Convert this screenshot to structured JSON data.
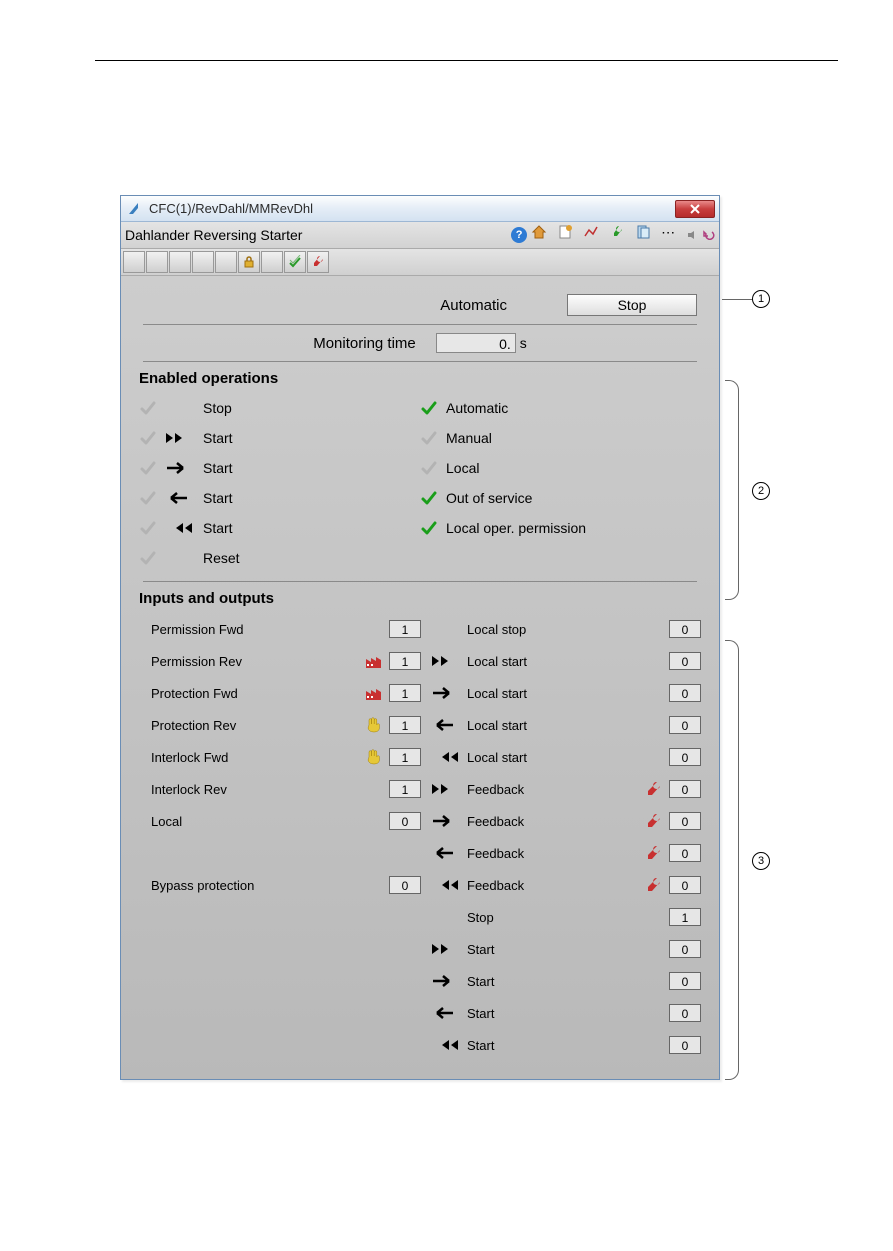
{
  "window": {
    "title": "CFC(1)/RevDahl/MMRevDhl",
    "subtitle": "Dahlander Reversing Starter"
  },
  "auto_row": {
    "label": "Automatic",
    "button": "Stop"
  },
  "monitoring": {
    "label": "Monitoring time",
    "value": "0.",
    "unit": "s"
  },
  "sections": {
    "enabled_ops": "Enabled operations",
    "io": "Inputs and outputs"
  },
  "ops_left": [
    {
      "label": "Stop",
      "chk": "gray",
      "arrow": ""
    },
    {
      "label": "Start",
      "chk": "gray",
      "arrow": "ff"
    },
    {
      "label": "Start",
      "chk": "gray",
      "arrow": "fwd"
    },
    {
      "label": "Start",
      "chk": "gray",
      "arrow": "rev"
    },
    {
      "label": "Start",
      "chk": "gray",
      "arrow": "rr"
    },
    {
      "label": "Reset",
      "chk": "gray",
      "arrow": ""
    }
  ],
  "ops_right": [
    {
      "label": "Automatic",
      "chk": "green"
    },
    {
      "label": "Manual",
      "chk": "gray"
    },
    {
      "label": "Local",
      "chk": "gray"
    },
    {
      "label": "Out of service",
      "chk": "green"
    },
    {
      "label": "Local oper. permission",
      "chk": "green"
    }
  ],
  "io_left": [
    {
      "label": "Permission Fwd",
      "val": "1",
      "icon": ""
    },
    {
      "label": "Permission Rev",
      "val": "1",
      "icon": "factory"
    },
    {
      "label": "Protection Fwd",
      "val": "1",
      "icon": "factory"
    },
    {
      "label": "Protection Rev",
      "val": "1",
      "icon": "hand"
    },
    {
      "label": "Interlock Fwd",
      "val": "1",
      "icon": "hand"
    },
    {
      "label": "Interlock Rev",
      "val": "1",
      "icon": ""
    },
    {
      "label": "Local",
      "val": "0",
      "icon": ""
    },
    {
      "label": "",
      "val": "",
      "icon": ""
    },
    {
      "label": "Bypass protection",
      "val": "0",
      "icon": ""
    }
  ],
  "io_right": [
    {
      "label": "Local stop",
      "arrow": "",
      "val": "0",
      "icon": ""
    },
    {
      "label": "Local start",
      "arrow": "ff",
      "val": "0",
      "icon": ""
    },
    {
      "label": "Local start",
      "arrow": "fwd",
      "val": "0",
      "icon": ""
    },
    {
      "label": "Local start",
      "arrow": "rev",
      "val": "0",
      "icon": ""
    },
    {
      "label": "Local start",
      "arrow": "rr",
      "val": "0",
      "icon": ""
    },
    {
      "label": "Feedback",
      "arrow": "ff",
      "val": "0",
      "icon": "wrench"
    },
    {
      "label": "Feedback",
      "arrow": "fwd",
      "val": "0",
      "icon": "wrench"
    },
    {
      "label": "Feedback",
      "arrow": "rev",
      "val": "0",
      "icon": "wrench"
    },
    {
      "label": "Feedback",
      "arrow": "rr",
      "val": "0",
      "icon": "wrench"
    },
    {
      "label": "Stop",
      "arrow": "",
      "val": "1",
      "icon": ""
    },
    {
      "label": "Start",
      "arrow": "ff",
      "val": "0",
      "icon": ""
    },
    {
      "label": "Start",
      "arrow": "fwd",
      "val": "0",
      "icon": ""
    },
    {
      "label": "Start",
      "arrow": "rev",
      "val": "0",
      "icon": ""
    },
    {
      "label": "Start",
      "arrow": "rr",
      "val": "0",
      "icon": ""
    }
  ],
  "callouts": {
    "c1": "1",
    "c2": "2",
    "c3": "3"
  }
}
